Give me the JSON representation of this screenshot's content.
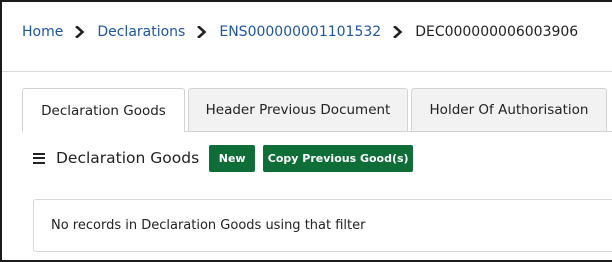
{
  "breadcrumb": {
    "items": [
      {
        "label": "Home"
      },
      {
        "label": "Declarations"
      },
      {
        "label": "ENS000000001101532"
      },
      {
        "label": "DEC000000006003906"
      }
    ],
    "separator_icon": "chevron-right-icon"
  },
  "tabs": [
    {
      "label": "Declaration Goods",
      "active": true
    },
    {
      "label": "Header Previous Document",
      "active": false
    },
    {
      "label": "Holder Of Authorisation",
      "active": false
    }
  ],
  "section": {
    "menu_icon": "hamburger-menu-icon",
    "title": "Declaration Goods",
    "new_button_label": "New",
    "copy_button_label": "Copy Previous Good(s)"
  },
  "empty_state": {
    "message": "No records in Declaration Goods using that filter"
  },
  "colors": {
    "link": "#1f56a3",
    "button_bg": "#0f6d38",
    "button_text": "#ffffff",
    "tab_inactive_bg": "#f2f2f2"
  }
}
